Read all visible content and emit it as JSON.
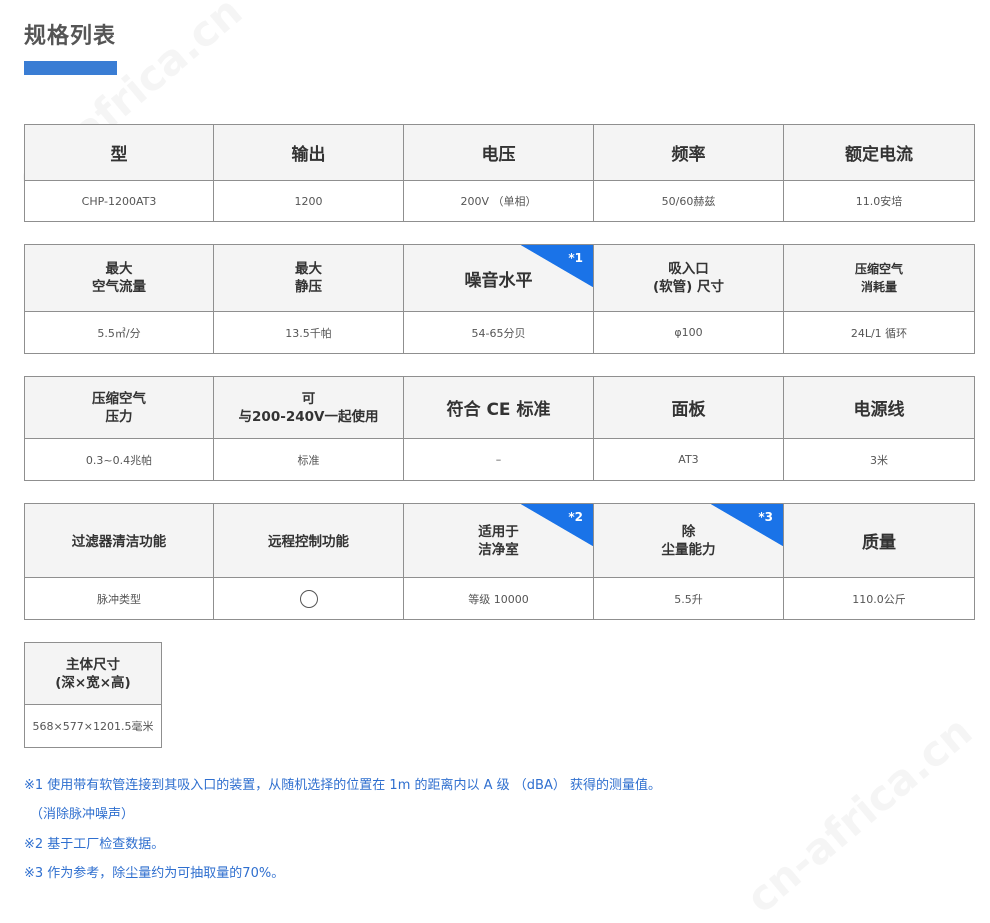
{
  "page": {
    "title": "规格列表",
    "watermark": "cn-africa.cn",
    "accent_color": "#3a7dd4",
    "badge_color": "#1a73e8",
    "note_color": "#2f6fcf"
  },
  "table1": {
    "headers": [
      "型",
      "输出",
      "电压",
      "频率",
      "额定电流"
    ],
    "values": [
      "CHP-1200AT3",
      "1200",
      "200V （单相）",
      "50/60赫兹",
      "11.0安培"
    ]
  },
  "table2": {
    "headers": [
      "最大\n空气流量",
      "最大\n静压",
      "噪音水平",
      "吸入口\n(软管) 尺寸",
      "压缩空气\n消耗量"
    ],
    "badge": "*1",
    "values": [
      "5.5㎥/分",
      "13.5千帕",
      "54-65分贝",
      "φ100",
      "24L/1 循环"
    ]
  },
  "table3": {
    "headers": [
      "压缩空气\n压力",
      "可\n与200-240V一起使用",
      "符合 CE 标准",
      "面板",
      "电源线"
    ],
    "values": [
      "0.3~0.4兆帕",
      "标准",
      "–",
      "AT3",
      "3米"
    ]
  },
  "table4": {
    "headers": [
      "过滤器清洁功能",
      "远程控制功能",
      "适用于\n洁净室",
      "除\n尘量能力",
      "质量"
    ],
    "badges": [
      "*2",
      "*3"
    ],
    "values": [
      "脉冲类型",
      "circle-icon",
      "等级 10000",
      "5.5升",
      "110.0公斤"
    ]
  },
  "table5": {
    "header": "主体尺寸\n(深×宽×高)",
    "value": "568×577×1201.5毫米"
  },
  "notes": [
    "※1 使用带有软管连接到其吸入口的装置，从随机选择的位置在 1m 的距离内以 A 级 （dBA） 获得的测量值。",
    "（消除脉冲噪声）",
    "※2 基于工厂检查数据。",
    "※3 作为参考，除尘量约为可抽取量的70%。"
  ]
}
